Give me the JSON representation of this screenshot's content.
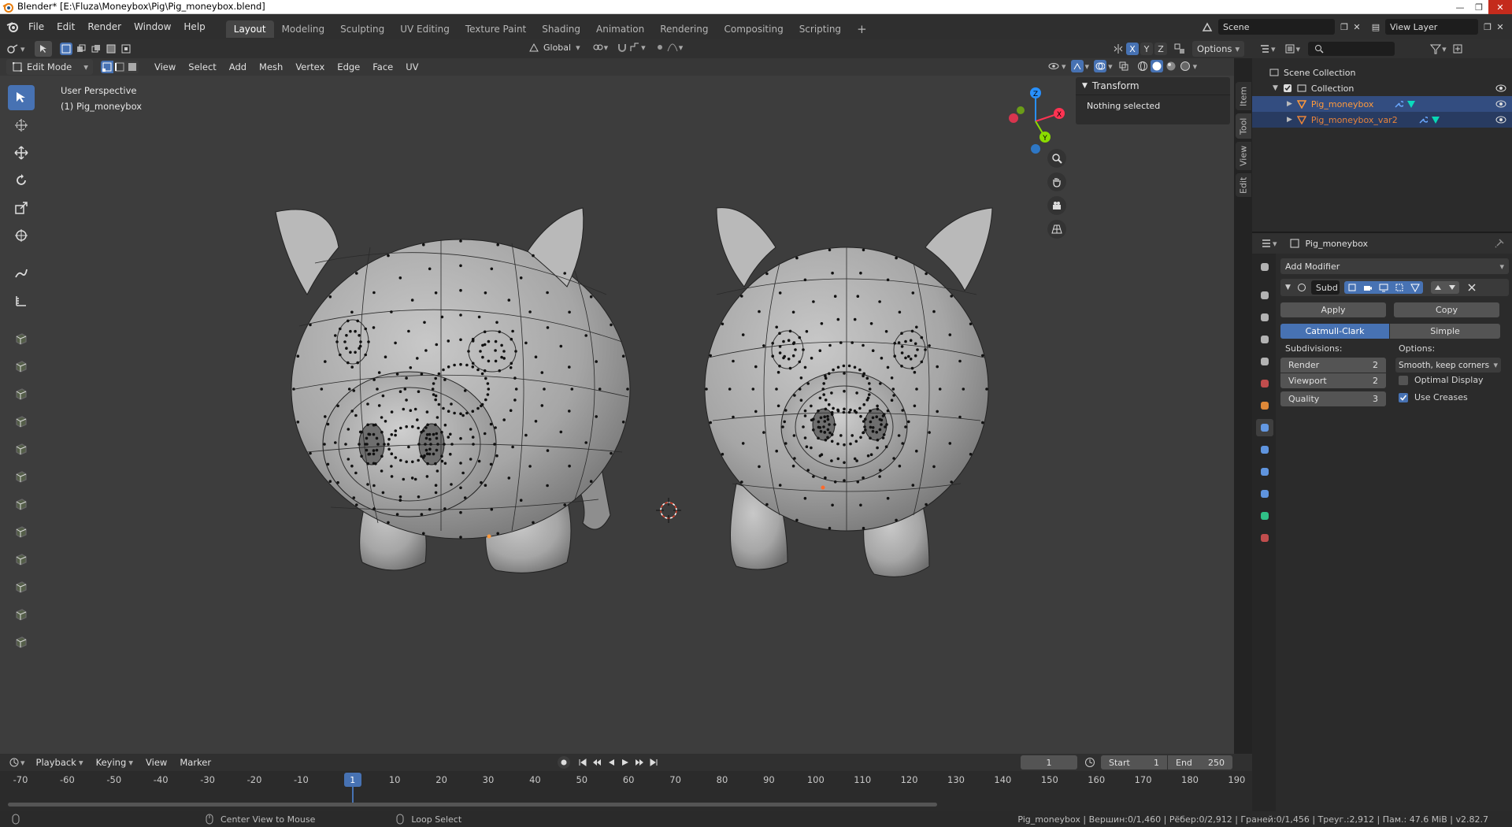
{
  "window": {
    "title": "Blender* [E:\\Fluza\\Moneybox\\Pig\\Pig_moneybox.blend]"
  },
  "menu": [
    "File",
    "Edit",
    "Render",
    "Window",
    "Help"
  ],
  "workspaces": [
    "Layout",
    "Modeling",
    "Sculpting",
    "UV Editing",
    "Texture Paint",
    "Shading",
    "Animation",
    "Rendering",
    "Compositing",
    "Scripting"
  ],
  "active_workspace": "Layout",
  "scene": {
    "name": "Scene",
    "view_layer": "View Layer"
  },
  "header": {
    "transform_orientation": "Global",
    "options": "Options",
    "axes": [
      "X",
      "Y",
      "Z"
    ]
  },
  "viewport_header": {
    "mode": "Edit Mode",
    "menus": [
      "View",
      "Select",
      "Add",
      "Mesh",
      "Vertex",
      "Edge",
      "Face",
      "UV"
    ]
  },
  "viewport": {
    "perspective": "User Perspective",
    "object_info": "(1) Pig_moneybox",
    "gizmo_axes": [
      "X",
      "Y",
      "Z"
    ]
  },
  "n_panel": {
    "section": "Transform",
    "message": "Nothing selected",
    "tabs": [
      "Item",
      "Tool",
      "View",
      "Edit"
    ]
  },
  "outliner": {
    "root": "Scene Collection",
    "collection": "Collection",
    "objects": [
      "Pig_moneybox",
      "Pig_moneybox_var2"
    ]
  },
  "properties": {
    "object": "Pig_moneybox",
    "add_modifier": "Add Modifier",
    "modifier_name": "Subd",
    "apply": "Apply",
    "copy": "Copy",
    "catmull": "Catmull-Clark",
    "simple": "Simple",
    "subdivisions_label": "Subdivisions:",
    "options_label": "Options:",
    "render_label": "Render",
    "render_value": "2",
    "viewport_label": "Viewport",
    "viewport_value": "2",
    "quality_label": "Quality",
    "quality_value": "3",
    "uv_smooth": "Smooth, keep corners",
    "optimal_display": "Optimal Display",
    "optimal_display_checked": false,
    "use_creases": "Use Creases",
    "use_creases_checked": true
  },
  "timeline": {
    "menus": [
      "Playback",
      "Keying",
      "View",
      "Marker"
    ],
    "current_frame": "1",
    "start_label": "Start",
    "start": "1",
    "end_label": "End",
    "end": "250",
    "ticks": [
      "-70",
      "-60",
      "-50",
      "-40",
      "-30",
      "-20",
      "-10",
      "10",
      "20",
      "30",
      "40",
      "50",
      "60",
      "70",
      "80",
      "90",
      "100",
      "110",
      "120",
      "130",
      "140",
      "150",
      "160",
      "170",
      "180",
      "190"
    ],
    "playhead": "1"
  },
  "statusbar": {
    "left_hint": "Center View to Mouse",
    "mid_hint": "Loop Select",
    "stats": "Pig_moneybox | Вершин:0/1,460 | Рёбер:0/2,912 | Граней:0/1,456 | Треуг.:2,912 | Пам.: 47.6 MiB | v2.82.7"
  },
  "colors": {
    "accent": "#4772b3",
    "selected_object": "#ff9a3c",
    "object_text": "#e8843b",
    "x_axis": "#ff3352",
    "y_axis": "#8bdc00",
    "z_axis": "#2890ff"
  }
}
